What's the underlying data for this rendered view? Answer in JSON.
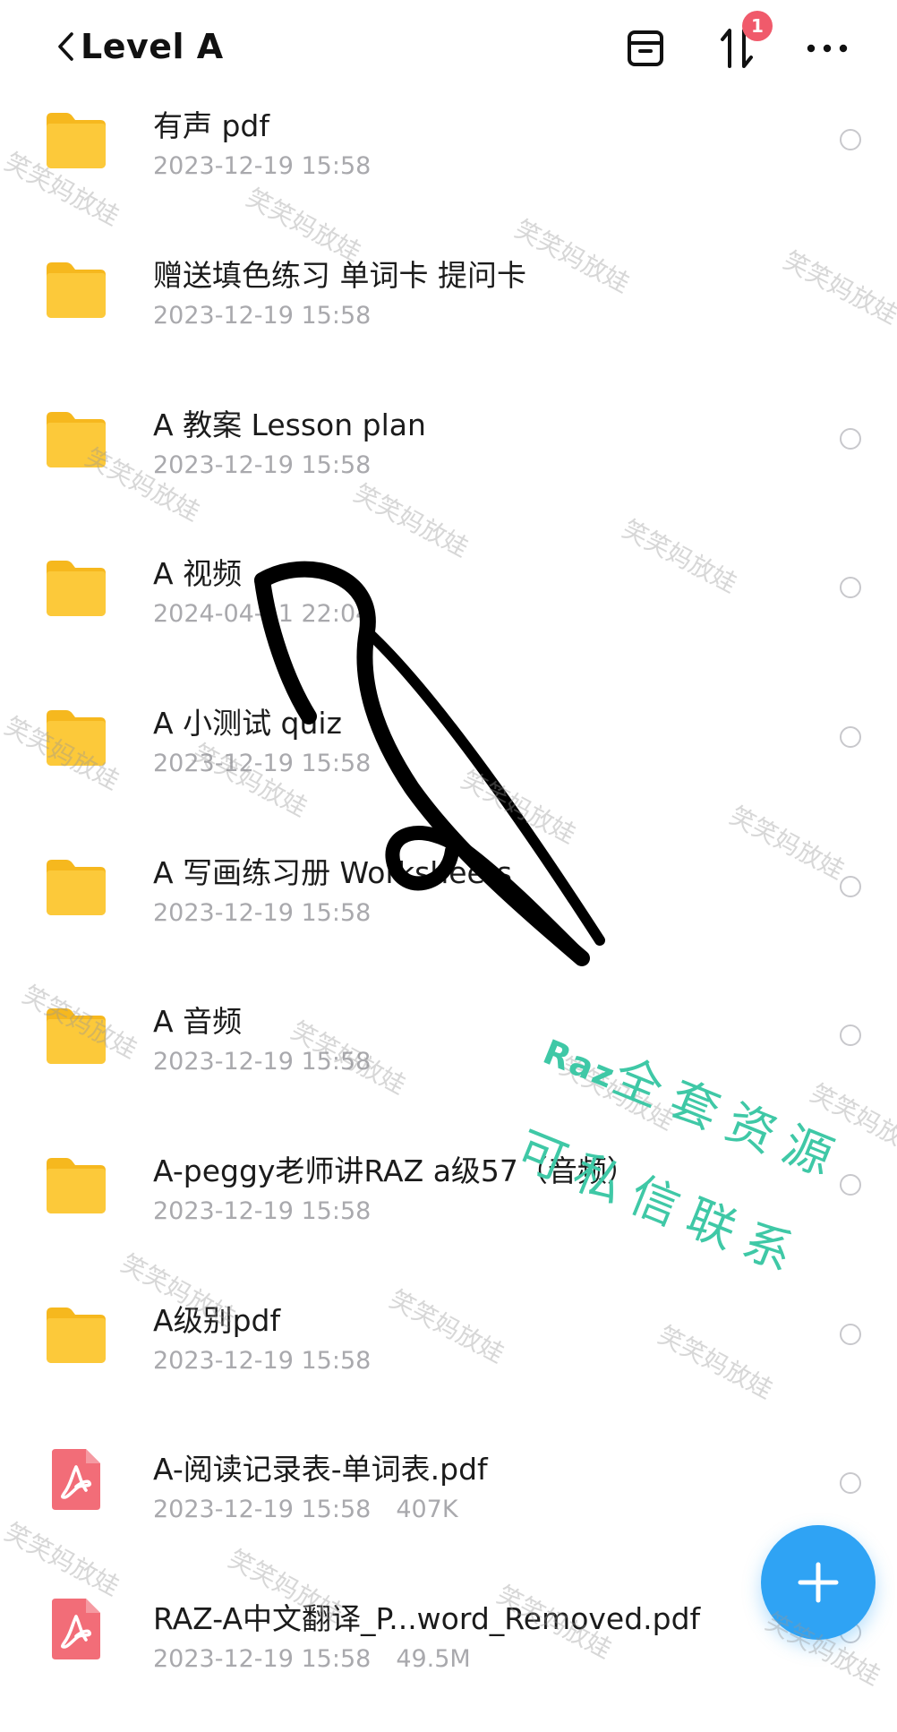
{
  "header": {
    "title": "Level A",
    "badge_count": "1"
  },
  "files": [
    {
      "name": "有声 pdf",
      "date": "2023-12-19 15:58",
      "size": "",
      "type": "folder"
    },
    {
      "name": "赠送填色练习 单词卡 提问卡",
      "date": "2023-12-19 15:58",
      "size": "",
      "type": "folder"
    },
    {
      "name": "A 教案 Lesson plan",
      "date": "2023-12-19 15:58",
      "size": "",
      "type": "folder"
    },
    {
      "name": "A 视频",
      "date": "2024-04-11 22:04",
      "size": "",
      "type": "folder"
    },
    {
      "name": "A 小测试 quiz",
      "date": "2023-12-19 15:58",
      "size": "",
      "type": "folder"
    },
    {
      "name": "A 写画练习册 Worksheets",
      "date": "2023-12-19 15:58",
      "size": "",
      "type": "folder"
    },
    {
      "name": "A 音频",
      "date": "2023-12-19 15:58",
      "size": "",
      "type": "folder"
    },
    {
      "name": "A-peggy老师讲RAZ a级57（音频）",
      "date": "2023-12-19 15:58",
      "size": "",
      "type": "folder"
    },
    {
      "name": "A级别pdf",
      "date": "2023-12-19 15:58",
      "size": "",
      "type": "folder"
    },
    {
      "name": "A-阅读记录表-单词表.pdf",
      "date": "2023-12-19 15:58",
      "size": "407K",
      "type": "pdf"
    },
    {
      "name": "RAZ-A中文翻译_P...word_Removed.pdf",
      "date": "2023-12-19 15:58",
      "size": "49.5M",
      "type": "pdf"
    }
  ],
  "watermark_text": "笑笑妈放娃",
  "promo": {
    "line1_prefix": "Raz",
    "line1": "全套资源",
    "line2": "可私信联系"
  },
  "colors": {
    "folder": "#fcc531",
    "pdf": "#f26d78",
    "fab": "#2fa3f4",
    "badge": "#f05a6b",
    "promo": "#3fc8a6"
  }
}
